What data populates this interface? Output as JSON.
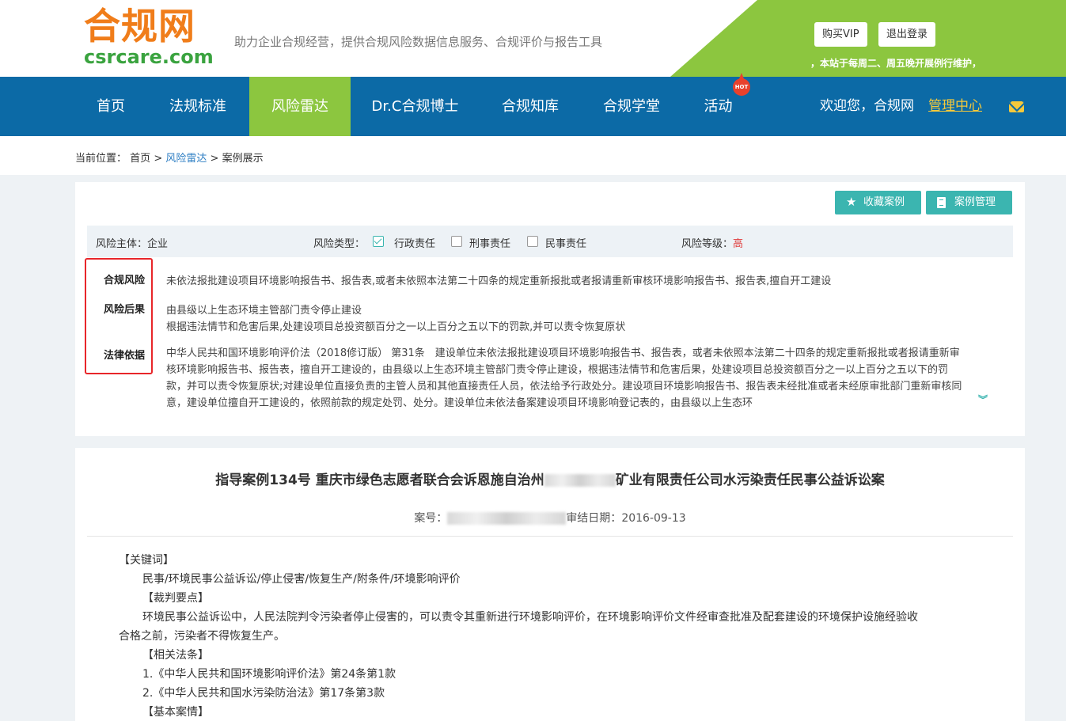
{
  "header": {
    "logo_cn": "合规网",
    "logo_en": "csrcare.com",
    "slogan": "助力企业合规经营，提供合规风险数据信息服务、合规评价与报告工具",
    "buy_vip": "购买VIP",
    "logout": "退出登录",
    "notice": "，本站于每周二、周五晚开展例行维护，"
  },
  "nav": {
    "items": [
      "首页",
      "法规标准",
      "风险雷达",
      "Dr.C合规博士",
      "合规知库",
      "合规学堂",
      "活动"
    ],
    "active_index": 2,
    "hot_badge": "HOT",
    "welcome": "欢迎您，合规网",
    "admin_link": "管理中心"
  },
  "breadcrumb": {
    "prefix": "当前位置：",
    "home": "首页",
    "sep": ">",
    "radar": "风险雷达",
    "current": "案例展示"
  },
  "toolbar": {
    "favorite_label": "收藏案例",
    "manage_label": "案例管理"
  },
  "filters": {
    "subject_label": "风险主体：",
    "subject_value": "企业",
    "type_label": "风险类型：",
    "types": [
      {
        "label": "行政责任",
        "checked": true
      },
      {
        "label": "刑事责任",
        "checked": false
      },
      {
        "label": "民事责任",
        "checked": false
      }
    ],
    "level_label": "风险等级：",
    "level_value": "高",
    "level_color": "#e03b3b"
  },
  "risk": {
    "compliance_label": "合规风险",
    "compliance_text": "未依法报批建设项目环境影响报告书、报告表,或者未依照本法第二十四条的规定重新报批或者报请重新审核环境影响报告书、报告表,擅自开工建设",
    "consequence_label": "风险后果",
    "consequence_lines": [
      "由县级以上生态环境主管部门责令停止建设",
      "根据违法情节和危害后果,处建设项目总投资额百分之一以上百分之五以下的罚款,并可以责令恢复原状"
    ],
    "legal_label": "法律依据",
    "legal_text": "中华人民共和国环境影响评价法（2018修订版） 第31条　建设单位未依法报批建设项目环境影响报告书、报告表，或者未依照本法第二十四条的规定重新报批或者报请重新审核环境影响报告书、报告表，擅自开工建设的，由县级以上生态环境主管部门责令停止建设，根据违法情节和危害后果，处建设项目总投资额百分之一以上百分之五以下的罚款，并可以责令恢复原状;对建设单位直接负责的主管人员和其他直接责任人员，依法给予行政处分。建设项目环境影响报告书、报告表未经批准或者未经原审批部门重新审核同意，建设单位擅自开工建设的，依照前款的规定处罚、处分。建设单位未依法备案建设项目环境影响登记表的，由县级以上生态环"
  },
  "case": {
    "title_prefix": "指导案例134号 重庆市绿色志愿者联合会诉恩施自治州",
    "title_suffix": "矿业有限责任公司水污染责任民事公益诉讼案",
    "case_no_label": "案号：",
    "date_label": "审结日期：",
    "date_value": "2016-09-13",
    "keywords_heading": "【关键词】",
    "keywords": "民事/环境民事公益诉讼/停止侵害/恢复生产/附条件/环境影响评价",
    "points_heading": "【裁判要点】",
    "points_line1": "环境民事公益诉讼中，人民法院判令污染者停止侵害的，可以责令其重新进行环境影响评价，在环境影响评价文件经审查批准及配套建设的环境保护设施经验收",
    "points_line2": "合格之前，污染者不得恢复生产。",
    "laws_heading": "【相关法条】",
    "law1": "1.《中华人民共和国环境影响评价法》第24条第1款",
    "law2": "2.《中华人民共和国水污染防治法》第17条第3款",
    "facts_heading": "【基本案情】"
  }
}
